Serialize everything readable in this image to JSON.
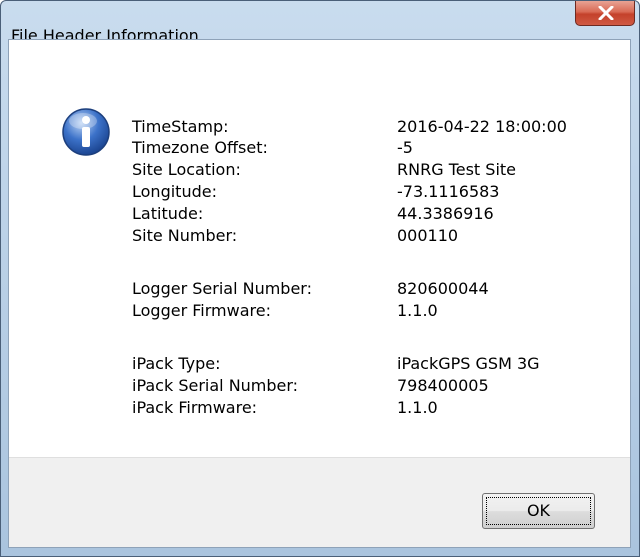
{
  "window": {
    "title": "File Header Information"
  },
  "icons": {
    "info": "information-icon",
    "close": "close-icon"
  },
  "fields": [
    {
      "label": "TimeStamp:",
      "value": "2016-04-22 18:00:00"
    },
    {
      "label": "Timezone Offset:",
      "value": "-5"
    },
    {
      "label": "Site Location:",
      "value": "RNRG Test Site"
    },
    {
      "label": "Longitude:",
      "value": "-73.1116583"
    },
    {
      "label": "Latitude:",
      "value": "44.3386916"
    },
    {
      "label": "Site Number:",
      "value": "000110"
    },
    {
      "label": "Logger Serial Number:",
      "value": "820600044"
    },
    {
      "label": "Logger Firmware:",
      "value": "1.1.0"
    },
    {
      "label": "iPack Type:",
      "value": "iPackGPS GSM 3G"
    },
    {
      "label": "iPack Serial Number:",
      "value": "798400005"
    },
    {
      "label": "iPack Firmware:",
      "value": "1.1.0"
    }
  ],
  "buttons": {
    "ok_label": "OK"
  }
}
